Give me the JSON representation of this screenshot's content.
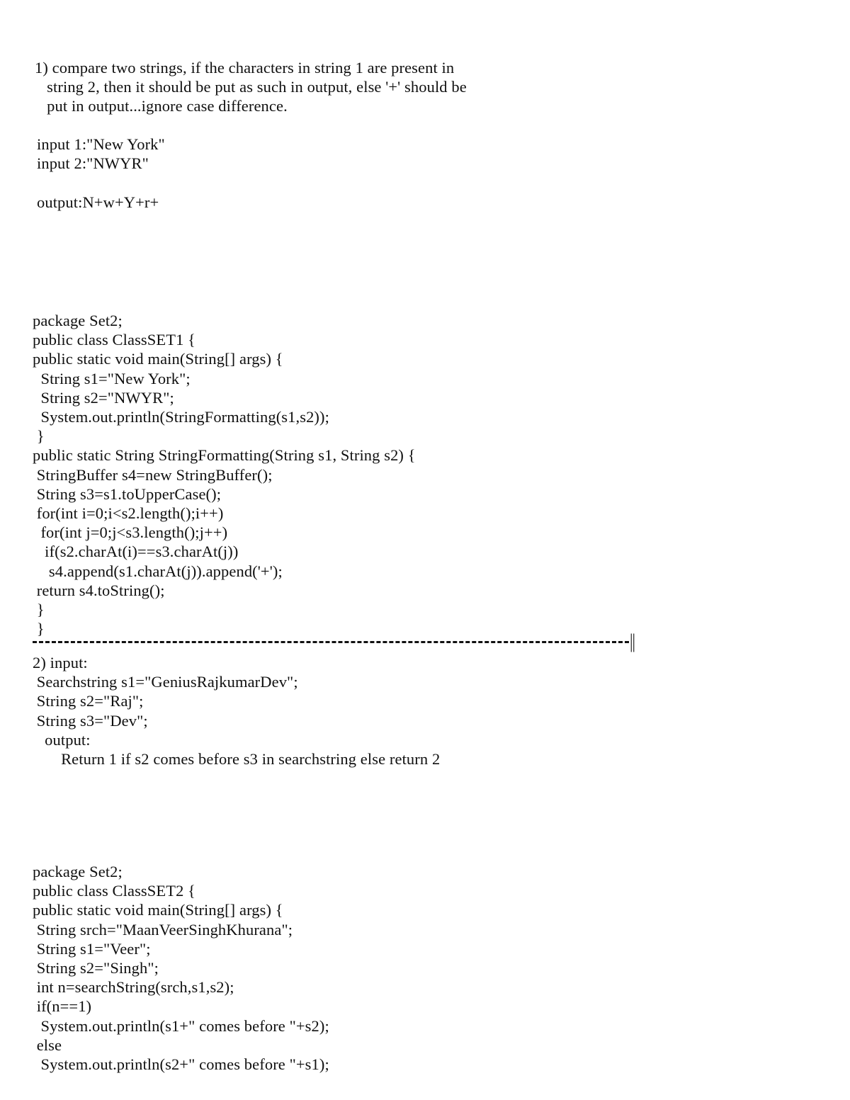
{
  "document": {
    "background_color": "#ffffff",
    "text_color": "#101010"
  },
  "section_1": {
    "problem_statement": "1) compare two strings, if the characters in string 1 are present in\n   string 2, then it should be put as such in output, else '+' should be\n   put in output...ignore case difference.",
    "inputs": "input 1:\"New York\"\ninput 2:\"NWYR\"",
    "output": "output:N+w+Y+r+",
    "code": "package Set2;\npublic class ClassSET1 {\npublic static void main(String[] args) {\n  String s1=\"New York\";\n  String s2=\"NWYR\";\n  System.out.println(StringFormatting(s1,s2));\n }\npublic static String StringFormatting(String s1, String s2) {\n StringBuffer s4=new StringBuffer();\n String s3=s1.toUpperCase();\n for(int i=0;i<s2.length();i++)\n  for(int j=0;j<s3.length();j++)\n   if(s2.charAt(i)==s3.charAt(j))\n    s4.append(s1.charAt(j)).append('+');\n return s4.toString();\n }\n }"
  },
  "separator": {
    "style": "dashed-horizontal-rule",
    "end_marker": "||"
  },
  "section_2": {
    "problem_statement": "2) input:\n Searchstring s1=\"GeniusRajkumarDev\";\n String s2=\"Raj\";\n String s3=\"Dev\";\n   output:\n       Return 1 if s2 comes before s3 in searchstring else return 2",
    "code": "package Set2;\npublic class ClassSET2 {\npublic static void main(String[] args) {\n String srch=\"MaanVeerSinghKhurana\";\n String s1=\"Veer\";\n String s2=\"Singh\";\n int n=searchString(srch,s1,s2);\n if(n==1)\n  System.out.println(s1+\" comes before \"+s2);\n else\n  System.out.println(s2+\" comes before \"+s1);"
  }
}
